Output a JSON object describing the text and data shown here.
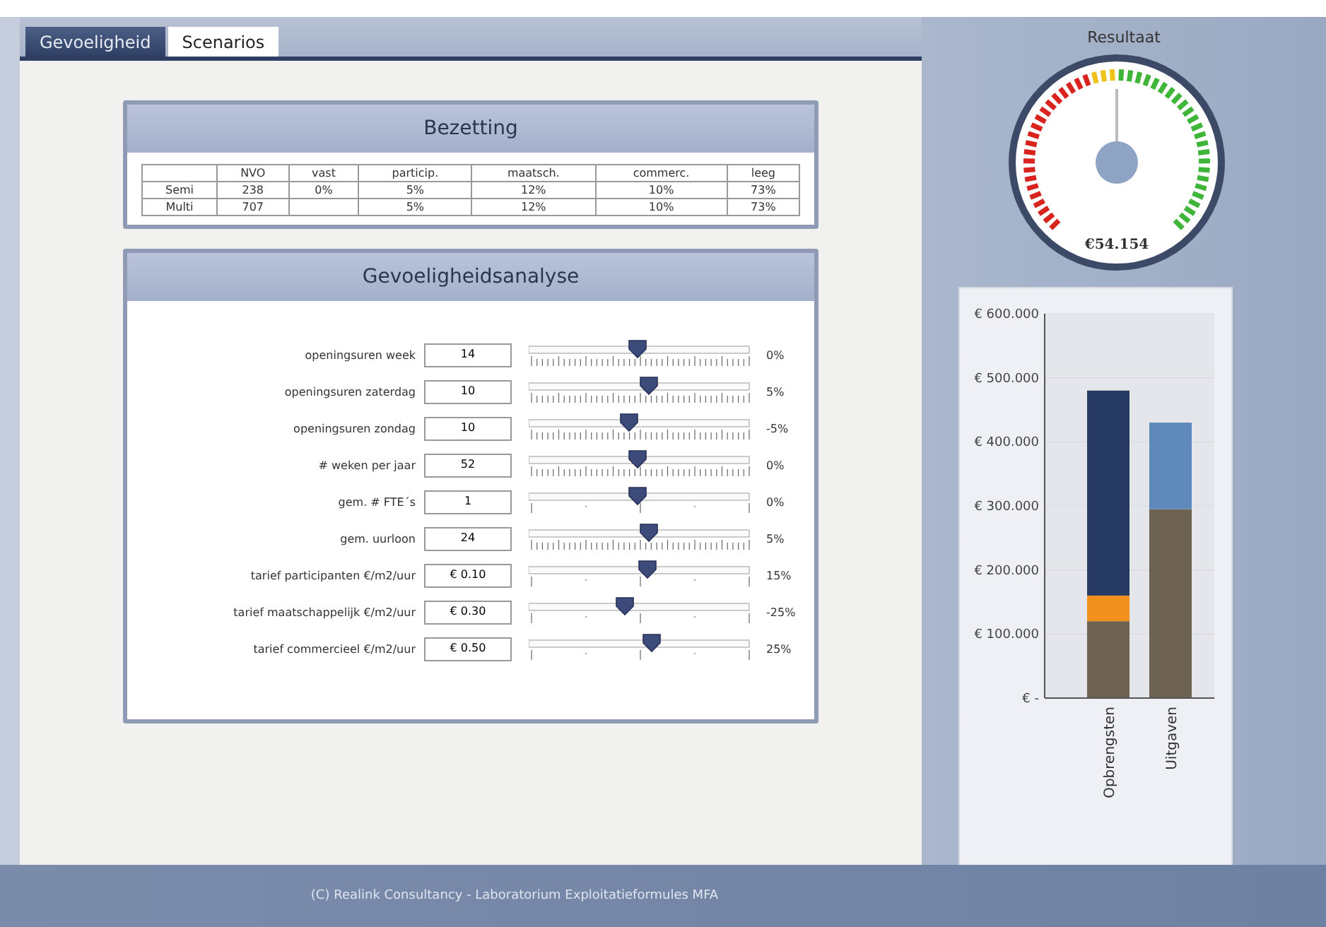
{
  "tabs": [
    {
      "label": "Gevoeligheid",
      "selected": true
    },
    {
      "label": "Scenarios",
      "selected": false
    }
  ],
  "bezetting": {
    "title": "Bezetting",
    "columns": [
      "",
      "NVO",
      "vast",
      "particip.",
      "maatsch.",
      "commerc.",
      "leeg"
    ],
    "rows": [
      [
        "Semi",
        "238",
        "0%",
        "5%",
        "12%",
        "10%",
        "73%"
      ],
      [
        "Multi",
        "707",
        "",
        "5%",
        "12%",
        "10%",
        "73%"
      ]
    ]
  },
  "analyse": {
    "title": "Gevoeligheidsanalyse",
    "rows": [
      {
        "label": "openingsuren week",
        "value": "14",
        "kind": "fine",
        "level": 0.49,
        "reading": "0%"
      },
      {
        "label": "openingsuren zaterdag",
        "value": "10",
        "kind": "fine",
        "level": 0.54,
        "reading": "5%"
      },
      {
        "label": "openingsuren zondag",
        "value": "10",
        "kind": "fine",
        "level": 0.45,
        "reading": "-5%"
      },
      {
        "label": "# weken per jaar",
        "value": "52",
        "kind": "fine",
        "level": 0.49,
        "reading": "0%"
      },
      {
        "label": "gem. # FTE´s",
        "value": "1",
        "kind": "coarse",
        "level": 0.49,
        "reading": "0%"
      },
      {
        "label": "gem. uurloon",
        "value": "24",
        "kind": "fine",
        "level": 0.54,
        "reading": "5%"
      },
      {
        "label": "tarief participanten €/m2/uur",
        "value": "€ 0.10",
        "kind": "coarse",
        "level": 0.53,
        "reading": "15%"
      },
      {
        "label": "tarief maatschappelijk  €/m2/uur",
        "value": "€ 0.30",
        "kind": "coarse",
        "level": 0.43,
        "reading": "-25%"
      },
      {
        "label": "tarief commercieel  €/m2/uur",
        "value": "€ 0.50",
        "kind": "coarse",
        "level": 0.55,
        "reading": "25%"
      }
    ]
  },
  "resultaat": {
    "title": "Resultaat",
    "value": "€54.154"
  },
  "chart": {
    "chart_data": {
      "type": "bar",
      "stacked": true,
      "grid": true,
      "orientation": "vertical",
      "categories": [
        "Opbrengsten",
        "Uitgaven"
      ],
      "series": [
        {
          "color": "#6e6353",
          "values": [
            120,
            295
          ]
        },
        {
          "color": "#f2901e",
          "values": [
            40,
            0
          ]
        },
        {
          "color": "#273a62",
          "values": [
            320,
            0
          ]
        },
        {
          "color": "#5f88bb",
          "values": [
            0,
            135
          ]
        }
      ],
      "ylim": [
        0,
        600
      ],
      "yticks": [
        {
          "value": 0,
          "label": "€ -"
        },
        {
          "value": 100,
          "label": "€ 100.000"
        },
        {
          "value": 200,
          "label": "€ 200.000"
        },
        {
          "value": 300,
          "label": "€ 300.000"
        },
        {
          "value": 400,
          "label": "€ 400.000"
        },
        {
          "value": 500,
          "label": "€ 500.000"
        },
        {
          "value": 600,
          "label": "€ 600.000"
        }
      ]
    }
  },
  "footer": "(C) Realink Consultancy - Laboratorium Exploitatieformules MFA"
}
